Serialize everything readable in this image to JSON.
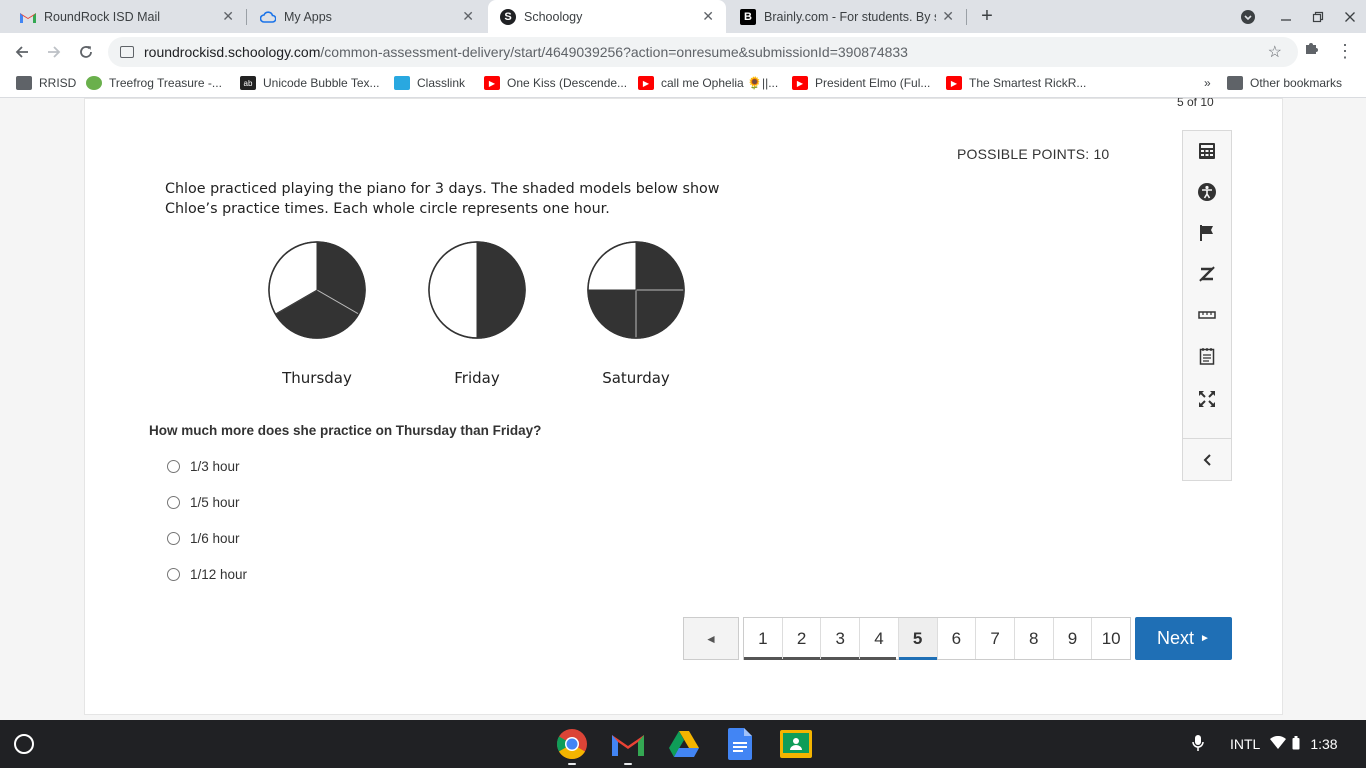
{
  "browser": {
    "tabs": [
      {
        "title": "RoundRock ISD Mail",
        "icon": "gmail-icon"
      },
      {
        "title": "My Apps",
        "icon": "cloud-icon"
      },
      {
        "title": "Schoology",
        "icon": "schoology-icon"
      },
      {
        "title": "Brainly.com - For students. By st",
        "icon": "brainly-icon"
      }
    ],
    "url_host": "roundrockisd.schoology.com",
    "url_path": "/common-assessment-delivery/start/4649039256?action=onresume&submissionId=390874833",
    "bookmarks": [
      {
        "label": "RRISD",
        "icon": "folder-icon"
      },
      {
        "label": "Treefrog Treasure -...",
        "icon": "frog-icon"
      },
      {
        "label": "Unicode Bubble Tex...",
        "icon": "unicode-icon"
      },
      {
        "label": "Classlink",
        "icon": "cloud-icon"
      },
      {
        "label": "One Kiss (Descende...",
        "icon": "youtube-icon"
      },
      {
        "label": "call me Ophelia 🌻||...",
        "icon": "youtube-icon"
      },
      {
        "label": "President Elmo (Ful...",
        "icon": "youtube-icon"
      },
      {
        "label": "The Smartest RickR...",
        "icon": "youtube-icon"
      }
    ],
    "other_bookmarks": "Other bookmarks",
    "more_bookmarks": "»"
  },
  "assessment": {
    "progress_clipped": "5 of 10",
    "possible_points": "POSSIBLE POINTS: 10",
    "stem_line1": "Chloe practiced playing the piano for 3 days. The shaded models below show",
    "stem_line2": "Chloe’s practice times.  Each whole circle represents one hour.",
    "models": [
      {
        "label": "Thursday",
        "shaded_fraction": 0.6667
      },
      {
        "label": "Friday",
        "shaded_fraction": 0.5
      },
      {
        "label": "Saturday",
        "shaded_fraction": 0.75
      }
    ],
    "question": "How much more does she practice on Thursday than Friday?",
    "choices": [
      "1/3 hour",
      "1/5 hour",
      "1/6 hour",
      "1/12 hour"
    ]
  },
  "pagination": {
    "prev": "◄",
    "pages": [
      "1",
      "2",
      "3",
      "4",
      "5",
      "6",
      "7",
      "8",
      "9",
      "10"
    ],
    "current": "5",
    "next": "Next",
    "next_arrow": "►"
  },
  "tools": [
    "calculator-icon",
    "accessibility-icon",
    "flag-icon",
    "eliminate-answer-icon",
    "ruler-icon",
    "notepad-icon",
    "fullscreen-icon",
    "collapse-icon"
  ],
  "shelf": {
    "apps": [
      "chrome-icon",
      "gmail-icon",
      "drive-icon",
      "docs-icon",
      "classroom-icon"
    ],
    "ime": "INTL",
    "time": "1:38"
  },
  "colors": {
    "accent": "#1f6fb5",
    "shade": "#333333"
  }
}
